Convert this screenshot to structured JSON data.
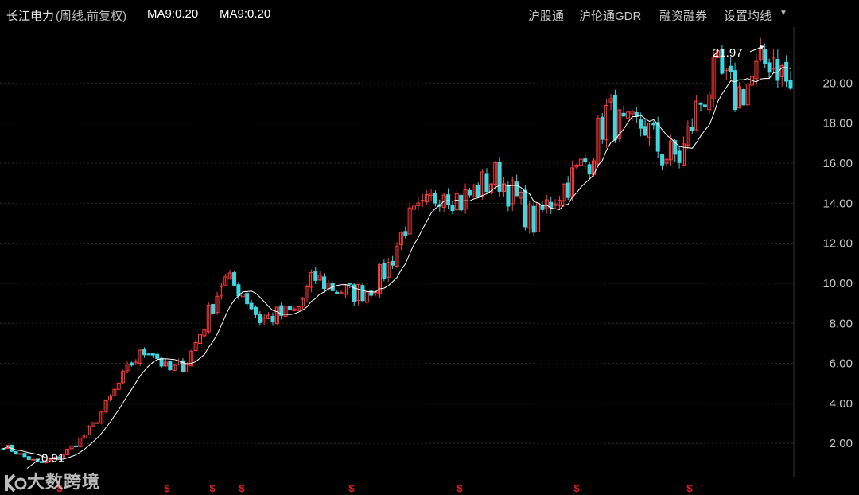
{
  "header": {
    "stock_name": "长江电力",
    "period": "(周线,前复权)",
    "ma1": "MA9:0.20",
    "ma2": "MA9:0.20",
    "menu": [
      "沪股通",
      "沪伦通GDR",
      "融资融券",
      "设置均线"
    ],
    "dropdown_icon": "caret-down-icon"
  },
  "watermark": "大数跨境",
  "colors": {
    "up": "#ff3b3b",
    "down": "#3fd6e0",
    "ma_line": "#ffffff",
    "grid": "#2a2a2a",
    "bg": "#000000",
    "event_marker": "#e02020"
  },
  "chart_data": {
    "type": "candlestick",
    "title": "",
    "y_ticks": [
      "20.00",
      "18.00",
      "16.00",
      "14.00",
      "12.00",
      "10.00",
      "8.00",
      "6.00",
      "4.00",
      "2.00"
    ],
    "ylim": [
      0.3,
      22.8
    ],
    "annotations": [
      {
        "label": "21.97",
        "type": "max",
        "value": 21.97
      },
      {
        "label": "0.91",
        "type": "min",
        "value": 0.91
      }
    ],
    "event_marker_label": "$",
    "event_marker_count": 8,
    "ma_series": {
      "name": "MA9"
    },
    "close_path": [
      1.9,
      1.4,
      1.0,
      1.3,
      2.0,
      3.0,
      4.5,
      6.0,
      6.8,
      5.6,
      6.0,
      8.0,
      10.2,
      9.7,
      8.2,
      8.4,
      8.6,
      10.3,
      9.8,
      9.5,
      9.7,
      10.8,
      13.0,
      13.6,
      14.9,
      14.1,
      14.8,
      15.4,
      14.2,
      13.0,
      14.3,
      15.2,
      16.3,
      18.6,
      17.5,
      18.0,
      16.4,
      16.3,
      19.0,
      20.5,
      19.3,
      20.3,
      21.5,
      19.6
    ]
  }
}
